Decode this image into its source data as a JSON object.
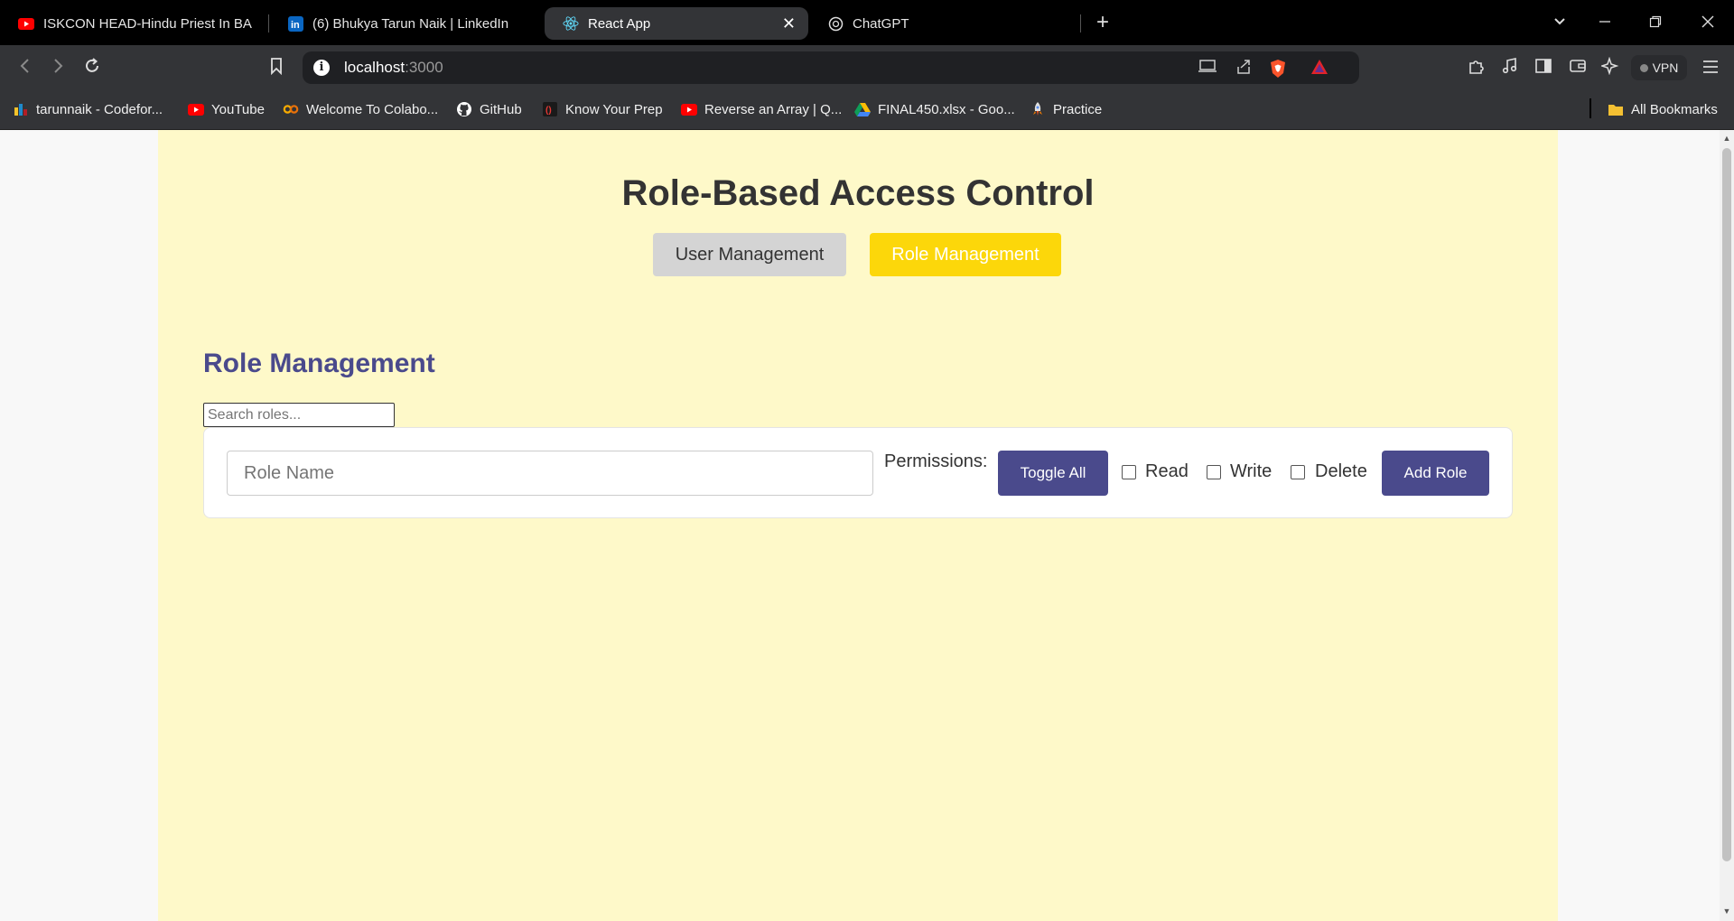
{
  "browser": {
    "tabs": [
      {
        "label": "ISKCON HEAD-Hindu Priest In BA",
        "icon": "youtube-icon"
      },
      {
        "label": "(6) Bhukya Tarun Naik | LinkedIn",
        "icon": "linkedin-icon"
      },
      {
        "label": "React App",
        "icon": "react-icon",
        "active": true
      },
      {
        "label": "ChatGPT",
        "icon": "chatgpt-icon"
      }
    ],
    "url_host": "localhost",
    "url_port": ":3000",
    "vpn_label": "VPN",
    "bookmarks": [
      {
        "label": "tarunnaik - Codefor...",
        "icon": "codeforces-icon"
      },
      {
        "label": "YouTube",
        "icon": "youtube-icon"
      },
      {
        "label": "Welcome To Colabo...",
        "icon": "colab-icon"
      },
      {
        "label": "GitHub",
        "icon": "github-icon"
      },
      {
        "label": "Know Your Prep",
        "icon": "knowyourprep-icon"
      },
      {
        "label": "Reverse an Array | Q...",
        "icon": "youtube-icon"
      },
      {
        "label": "FINAL450.xlsx - Goo...",
        "icon": "google-drive-icon"
      },
      {
        "label": "Practice",
        "icon": "rocket-icon"
      }
    ],
    "all_bookmarks": "All Bookmarks"
  },
  "app": {
    "title": "Role-Based Access Control",
    "nav": {
      "user_management": "User Management",
      "role_management": "Role Management"
    },
    "section_title": "Role Management",
    "search_placeholder": "Search roles...",
    "form": {
      "role_name_placeholder": "Role Name",
      "permissions_label": "Permissions:",
      "toggle_all": "Toggle All",
      "permissions": [
        "Read",
        "Write",
        "Delete"
      ],
      "add_role": "Add Role"
    }
  },
  "colors": {
    "app_background": "#fef9c9",
    "accent_purple": "#4a4a8c",
    "active_nav_yellow": "#fcd70a",
    "inactive_nav_gray": "#d4d4d4"
  }
}
